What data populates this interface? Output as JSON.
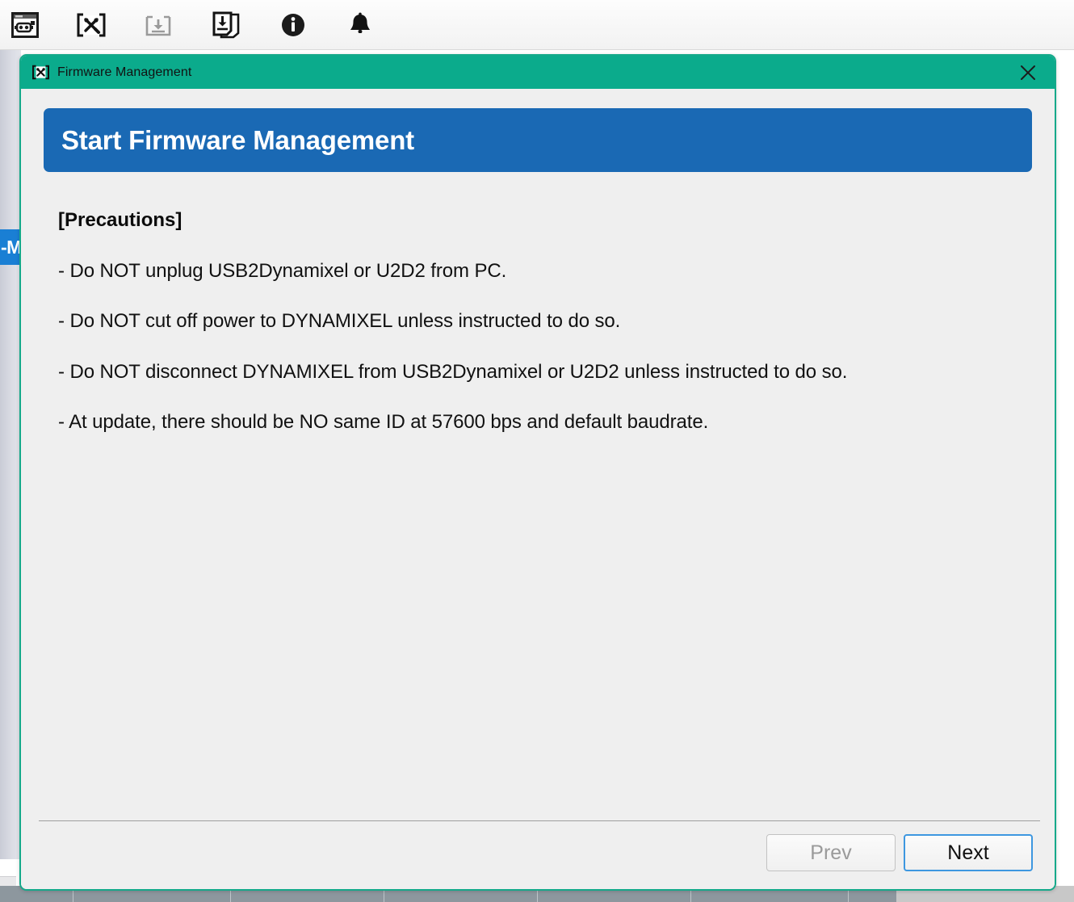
{
  "toolbar": {
    "items": [
      {
        "name": "robot-window-icon",
        "label": "Scan / Device Window",
        "state": "enabled"
      },
      {
        "name": "firmware-tools-icon",
        "label": "Firmware Management",
        "state": "enabled"
      },
      {
        "name": "download-icon",
        "label": "Save",
        "state": "disabled"
      },
      {
        "name": "save-all-icon",
        "label": "Save All",
        "state": "enabled"
      },
      {
        "name": "info-icon",
        "label": "Information",
        "state": "enabled"
      },
      {
        "name": "bell-icon",
        "label": "Notifications",
        "state": "enabled"
      }
    ]
  },
  "background": {
    "sidebar_selected_label": "-M"
  },
  "dialog": {
    "titlebar": {
      "icon": "firmware-tools-icon",
      "title": "Firmware Management",
      "close_label": "×"
    },
    "banner": {
      "title": "Start Firmware Management"
    },
    "content": {
      "heading": "[Precautions]",
      "lines": [
        "- Do NOT unplug USB2Dynamixel or U2D2 from PC.",
        "- Do NOT cut off power to DYNAMIXEL unless instructed to do so.",
        "- Do NOT disconnect DYNAMIXEL from USB2Dynamixel or U2D2 unless instructed to do so.",
        "- At update, there should be NO same ID at 57600 bps and default baudrate."
      ]
    },
    "footer": {
      "prev_label": "Prev",
      "next_label": "Next"
    }
  },
  "colors": {
    "titlebar_teal": "#0bab8c",
    "dialog_border_teal": "#14a98a",
    "banner_blue": "#1a69b4",
    "focus_blue": "#3d97e0",
    "body_gray": "#efefef",
    "sidebar_selected_blue": "#1a7fd4"
  }
}
